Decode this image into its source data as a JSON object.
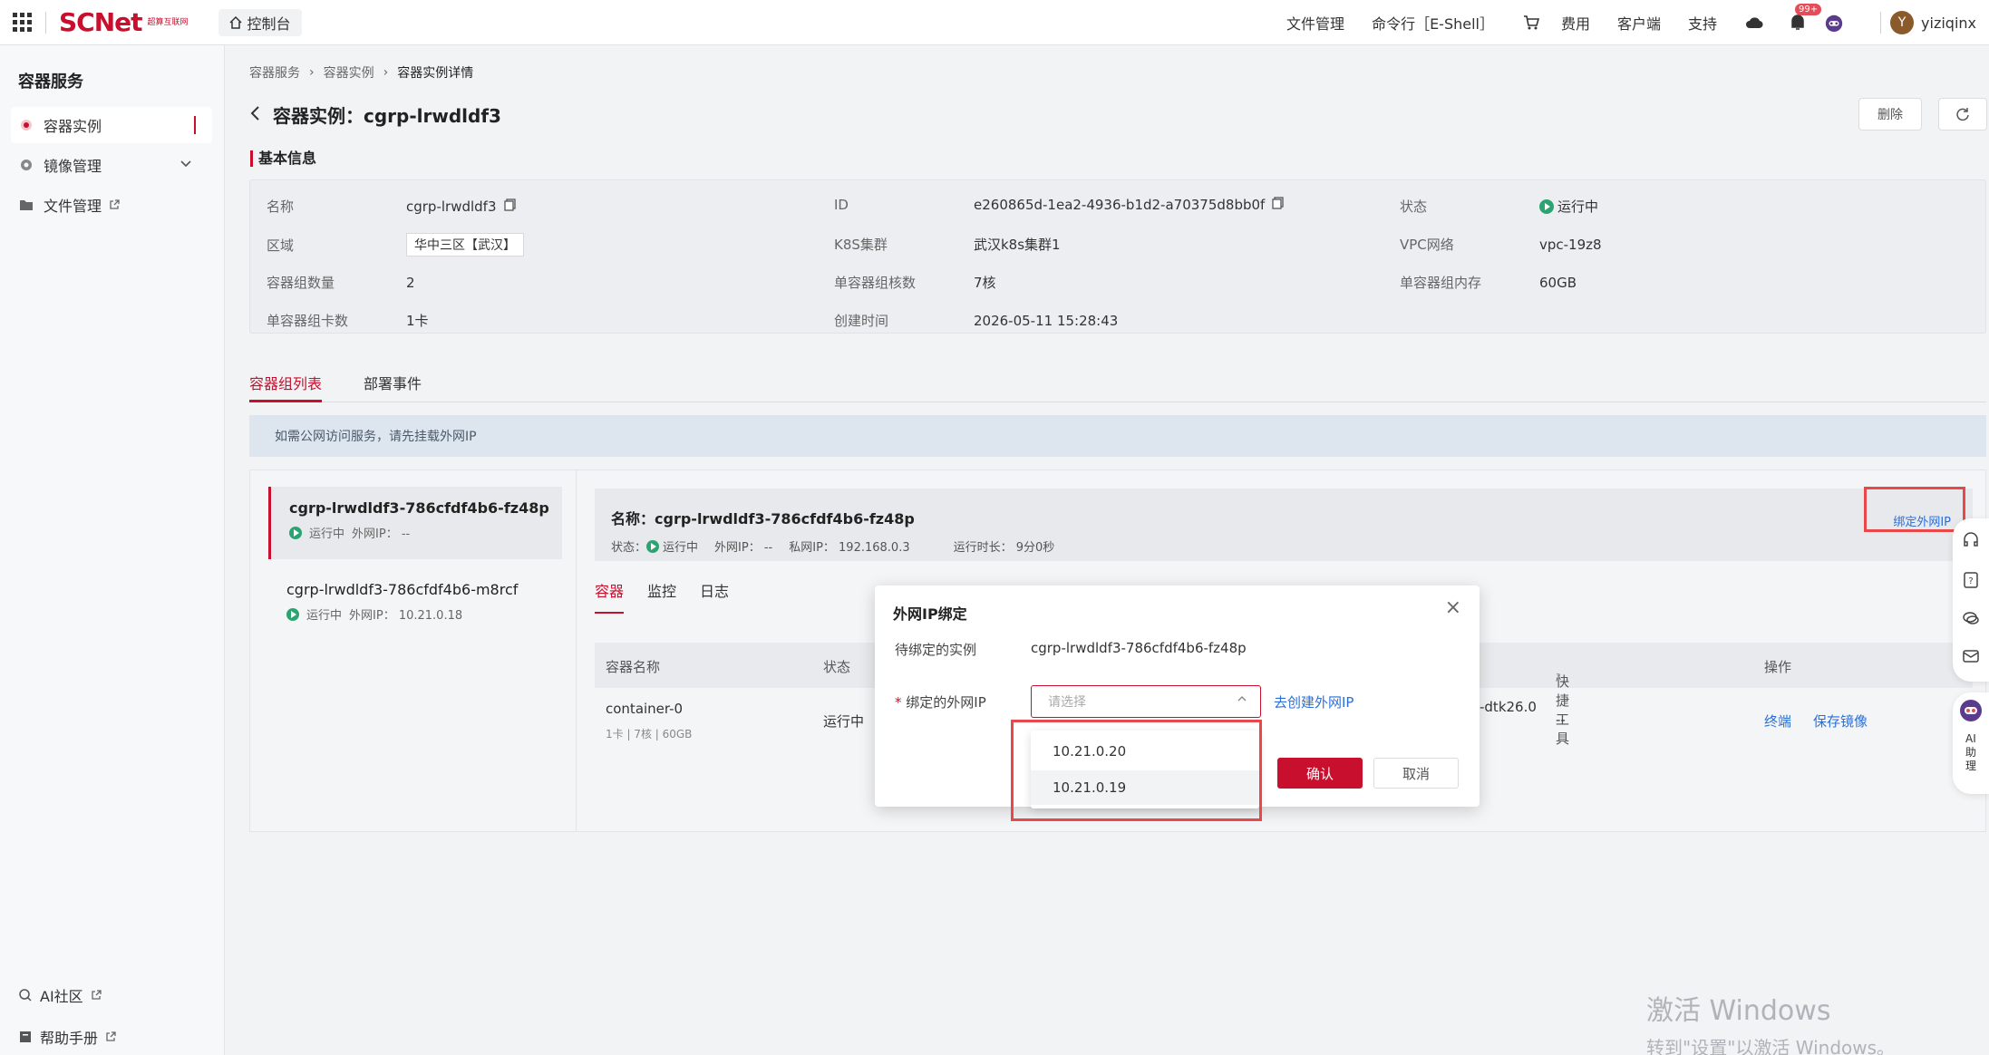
{
  "topbar": {
    "logo": "SCNet",
    "logo_sub": "超算互联网",
    "console": "控制台",
    "links": [
      "文件管理",
      "命令行［E-Shell］",
      "费用",
      "客户端",
      "支持"
    ],
    "badge": "99+",
    "user_initial": "Y",
    "username": "yiziqinx"
  },
  "sidebar": {
    "title": "容器服务",
    "items": [
      {
        "label": "容器实例"
      },
      {
        "label": "镜像管理"
      },
      {
        "label": "文件管理"
      }
    ],
    "bottom": [
      {
        "label": "AI社区"
      },
      {
        "label": "帮助手册"
      }
    ]
  },
  "breadcrumb": [
    "容器服务",
    "容器实例",
    "容器实例详情"
  ],
  "page": {
    "title_prefix": "容器实例：",
    "title_name": "cgrp-lrwdldf3",
    "delete": "删除"
  },
  "basic": {
    "title": "基本信息",
    "name_k": "名称",
    "name_v": "cgrp-lrwdldf3",
    "id_k": "ID",
    "id_v": "e260865d-1ea2-4936-b1d2-a70375d8bb0f",
    "status_k": "状态",
    "status_v": "运行中",
    "region_k": "区域",
    "region_v": "华中三区【武汉】",
    "k8s_k": "K8S集群",
    "k8s_v": "武汉k8s集群1",
    "vpc_k": "VPC网络",
    "vpc_v": "vpc-19z8",
    "count_k": "容器组数量",
    "count_v": "2",
    "cores_k": "单容器组核数",
    "cores_v": "7核",
    "mem_k": "单容器组内存",
    "mem_v": "60GB",
    "cards_k": "单容器组卡数",
    "cards_v": "1卡",
    "created_k": "创建时间",
    "created_v": "2026-05-11 15:28:43"
  },
  "tabs": [
    "容器组列表",
    "部署事件"
  ],
  "notice": "如需公网访问服务，请先挂载外网IP",
  "groups": [
    {
      "name": "cgrp-lrwdldf3-786cfdf4b6-fz48p",
      "status": "运行中",
      "ip": "外网IP：  --"
    },
    {
      "name": "cgrp-lrwdldf3-786cfdf4b6-m8rcf",
      "status": "运行中",
      "ip": "外网IP：  10.21.0.18"
    }
  ],
  "detail": {
    "name_label": "名称：",
    "name": "cgrp-lrwdldf3-786cfdf4b6-fz48p",
    "status_label": "状态：",
    "status": "运行中",
    "ext_ip": "外网IP：  --",
    "priv_ip": "私网IP：  192.168.0.3",
    "uptime": "运行时长：  9分0秒",
    "bind_btn": "绑定外网IP",
    "sub_tabs": [
      "容器",
      "监控",
      "日志"
    ],
    "columns": [
      "容器名称",
      "状态",
      "快捷工具",
      "操作"
    ],
    "row": {
      "name": "container-0",
      "spec": "1卡 | 7核 | 60GB",
      "status": "运行中",
      "image_tail": "-dtk26.0",
      "tools": "--",
      "op1": "终端",
      "op2": "保存镜像"
    }
  },
  "modal": {
    "title": "外网IP绑定",
    "instance_label": "待绑定的实例",
    "instance_value": "cgrp-lrwdldf3-786cfdf4b6-fz48p",
    "ip_label": "绑定的外网IP",
    "required_mark": "*",
    "placeholder": "请选择",
    "create_link": "去创建外网IP",
    "confirm": "确认",
    "cancel": "取消",
    "options": [
      "10.21.0.20",
      "10.21.0.19"
    ]
  },
  "float_ai": "AI助理",
  "watermark": {
    "line1": "激活 Windows",
    "line2": "转到\"设置\"以激活 Windows。"
  },
  "colors": {
    "brand": "#c8102e",
    "link": "#2b6fd6",
    "running": "#2ba471",
    "highlight": "#e8484a"
  }
}
